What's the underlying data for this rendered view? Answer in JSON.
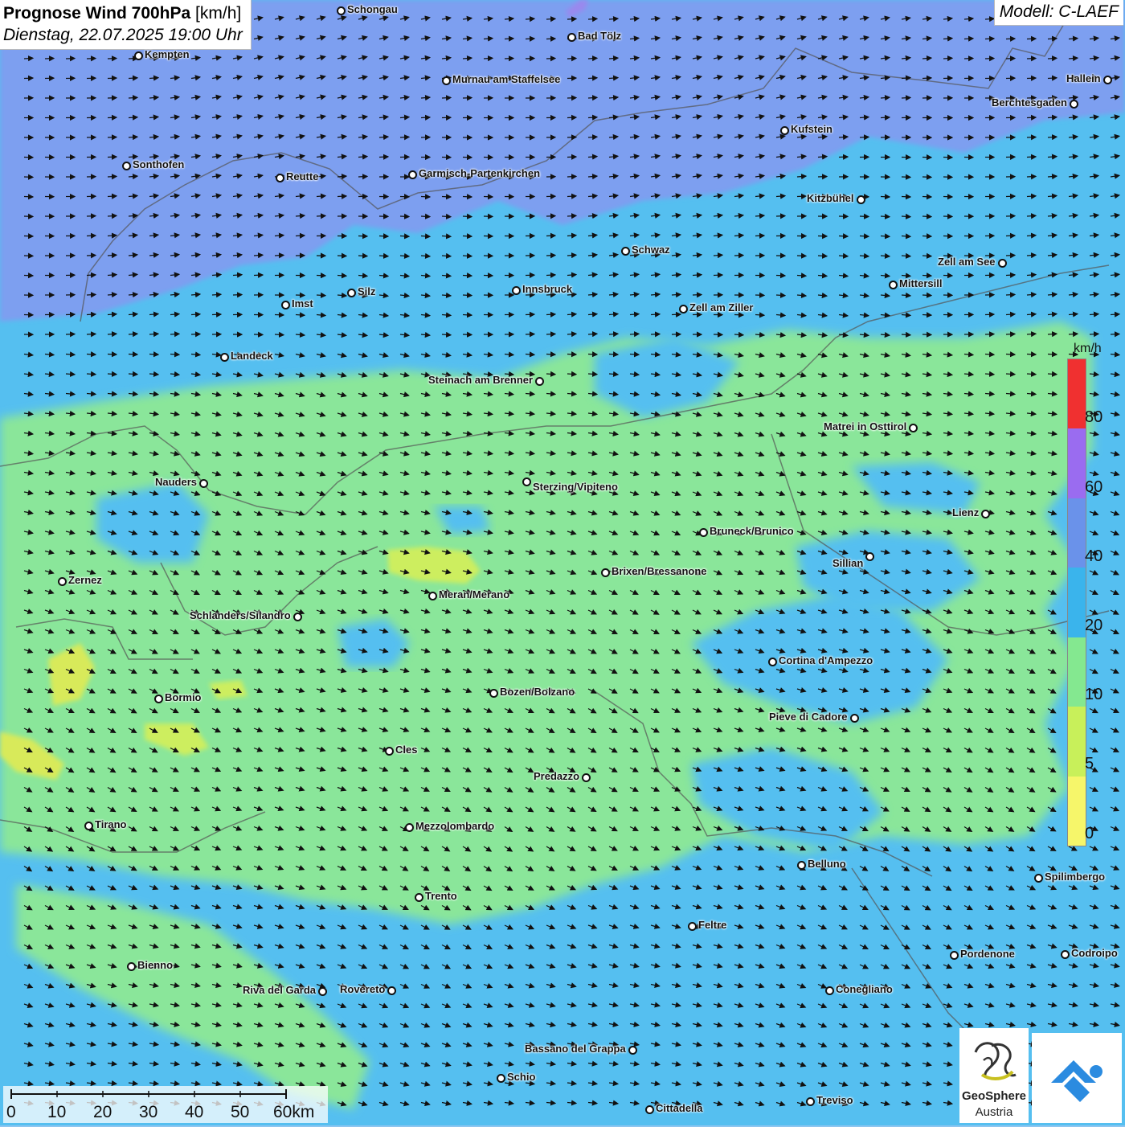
{
  "header": {
    "title_bold": "Prognose Wind 700hPa",
    "title_unit": "[km/h]",
    "datetime": "Dienstag, 22.07.2025 19:00 Uhr",
    "model": "Modell: C-LAEF"
  },
  "colors": {
    "band_80": "#f03030",
    "band_60": "#9a6cf0",
    "band_40": "#6a92ea",
    "band_20": "#3ab4ec",
    "band_10": "#84e890",
    "band_5": "#c8f05a",
    "band_0": "#f6f66a",
    "background_north": "#7d9ff0",
    "background_mid": "#52c0f0",
    "background_south": "#8ce6a0"
  },
  "legend": {
    "unit": "km/h",
    "ticks": [
      "80",
      "60",
      "40",
      "20",
      "10",
      "5",
      "0"
    ]
  },
  "scale_bar": {
    "labels": [
      "0",
      "10",
      "20",
      "30",
      "40",
      "50",
      "60km"
    ]
  },
  "logos": {
    "geosphere_line1": "GeoSphere",
    "geosphere_line2": "Austria",
    "geosphere_icon": "geosphere-logo-icon",
    "partner_icon": "partner-logo-icon"
  },
  "cities": [
    {
      "name": "Schongau"
    },
    {
      "name": "Bad Tölz"
    },
    {
      "name": "Kempten"
    },
    {
      "name": "Murnau am Staffelsee"
    },
    {
      "name": "Hallein"
    },
    {
      "name": "Berchtesgaden"
    },
    {
      "name": "Kufstein"
    },
    {
      "name": "Sonthofen"
    },
    {
      "name": "Reutte"
    },
    {
      "name": "Garmisch-Partenkirchen"
    },
    {
      "name": "Kitzbühel"
    },
    {
      "name": "Schwaz"
    },
    {
      "name": "Zell am See"
    },
    {
      "name": "Mittersill"
    },
    {
      "name": "Innsbruck"
    },
    {
      "name": "Silz"
    },
    {
      "name": "Imst"
    },
    {
      "name": "Zell am Ziller"
    },
    {
      "name": "Landeck"
    },
    {
      "name": "Steinach am Brenner"
    },
    {
      "name": "Matrei in Osttirol"
    },
    {
      "name": "Nauders"
    },
    {
      "name": "Sterzing/Vipiteno"
    },
    {
      "name": "Lienz"
    },
    {
      "name": "Bruneck/Brunico"
    },
    {
      "name": "Sillian"
    },
    {
      "name": "Zernez"
    },
    {
      "name": "Brixen/Bressanone"
    },
    {
      "name": "Meran/Merano"
    },
    {
      "name": "Schlanders/Silandro"
    },
    {
      "name": "Cortina d'Ampezzo"
    },
    {
      "name": "Bormio"
    },
    {
      "name": "Bozen/Bolzano"
    },
    {
      "name": "Pieve di Cadore"
    },
    {
      "name": "Cles"
    },
    {
      "name": "Predazzo"
    },
    {
      "name": "Tirano"
    },
    {
      "name": "Mezzolombardo"
    },
    {
      "name": "Belluno"
    },
    {
      "name": "Spilimbergo"
    },
    {
      "name": "Trento"
    },
    {
      "name": "Feltre"
    },
    {
      "name": "Pordenone"
    },
    {
      "name": "Codroipo"
    },
    {
      "name": "Bienno"
    },
    {
      "name": "Riva del Garda"
    },
    {
      "name": "Rovereto"
    },
    {
      "name": "Conegliano"
    },
    {
      "name": "Bassano del Grappa"
    },
    {
      "name": "Schio"
    },
    {
      "name": "Treviso"
    },
    {
      "name": "Cittadella"
    }
  ]
}
